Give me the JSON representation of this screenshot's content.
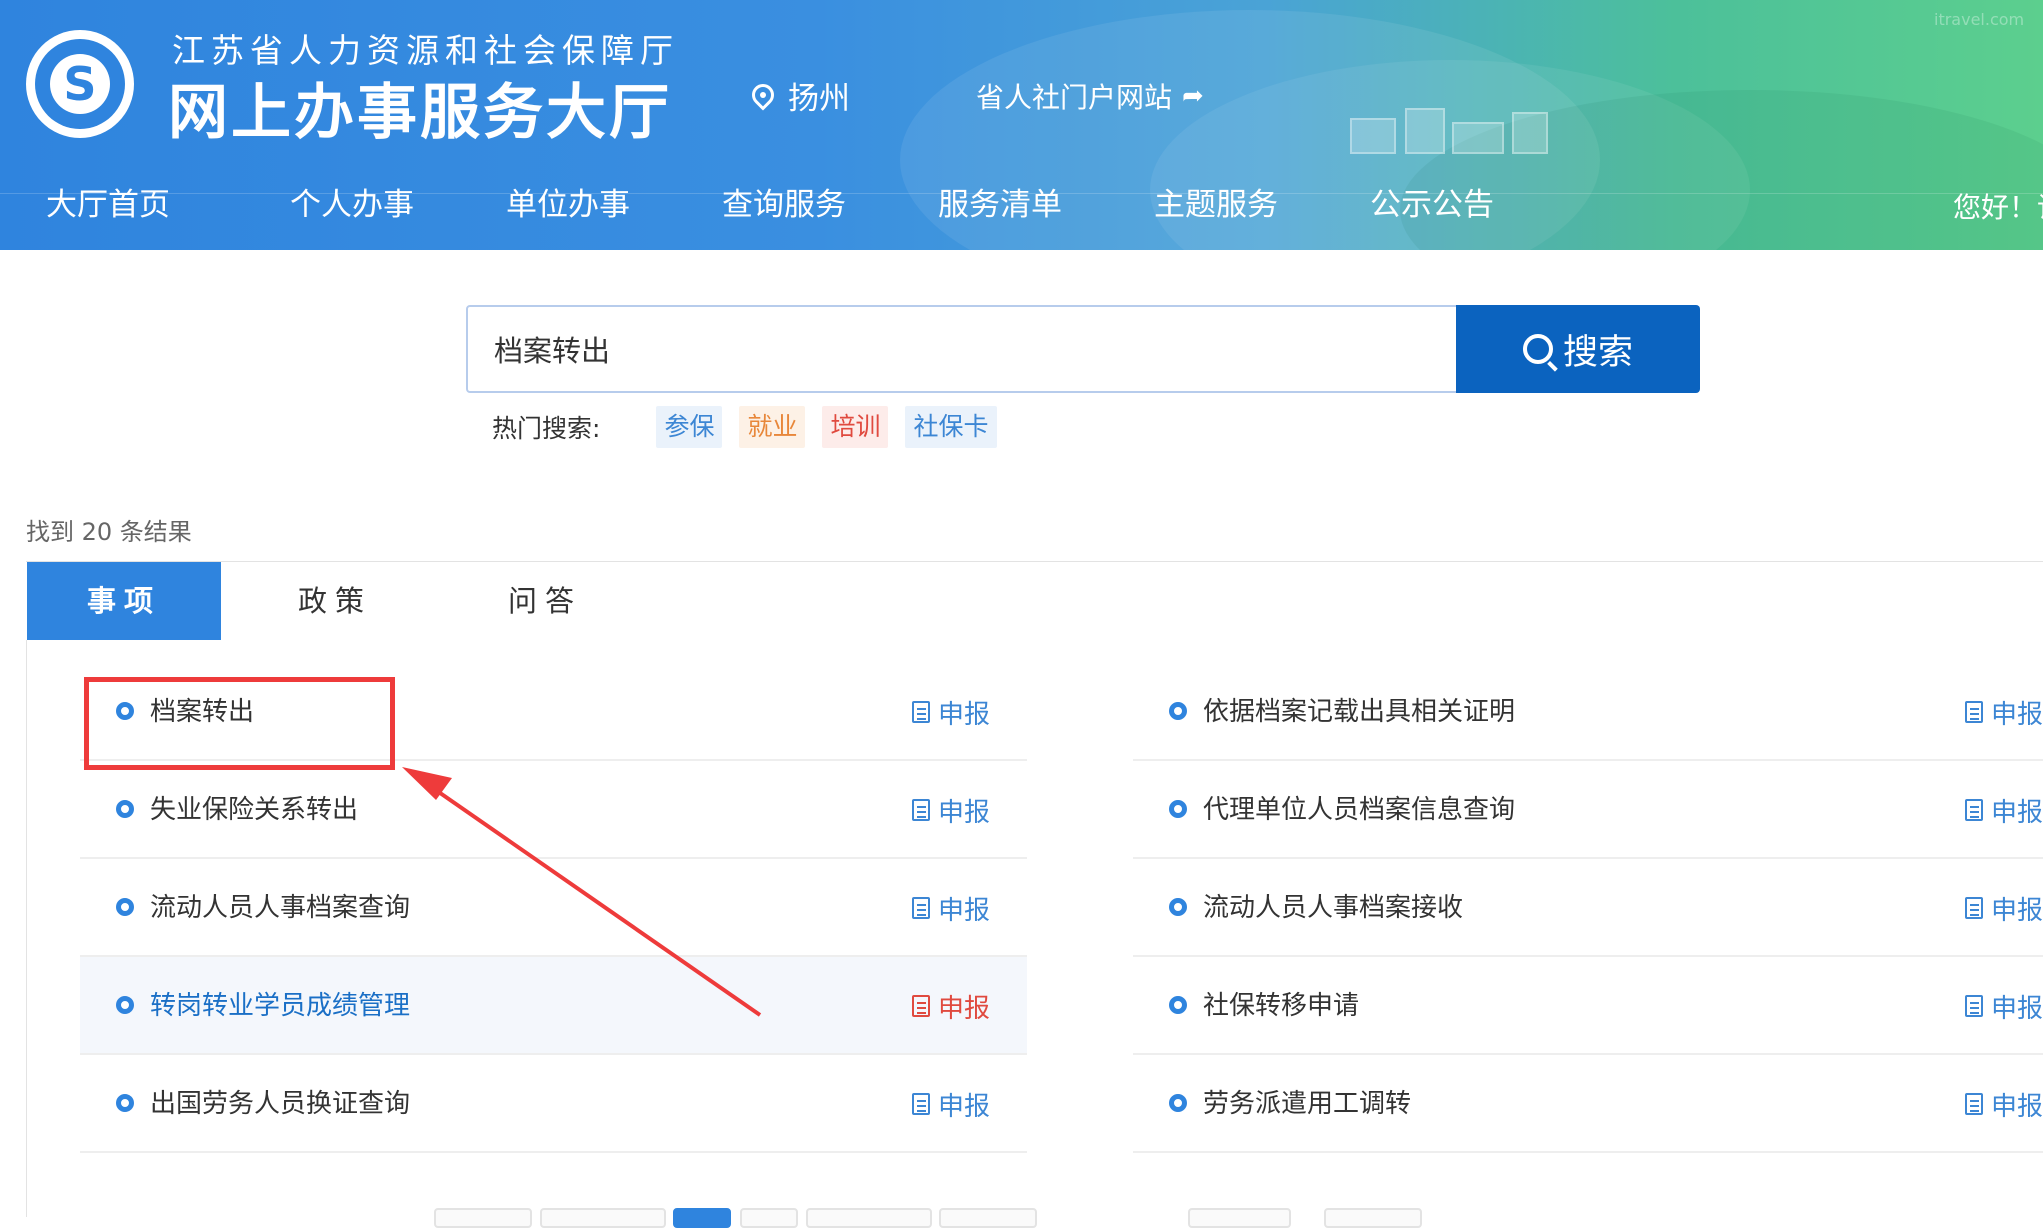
{
  "header": {
    "subtitle": "江苏省人力资源和社会保障厅",
    "title": "网上办事服务大厅",
    "location": "扬州",
    "portal_link": "省人社门户网站",
    "greeting": "您好！请",
    "nav": [
      "大厅首页",
      "个人办事",
      "单位办事",
      "查询服务",
      "服务清单",
      "主题服务",
      "公示公告"
    ],
    "watermark": "itravel.com"
  },
  "search": {
    "value": "档案转出",
    "button_label": "搜索",
    "hot_label": "热门搜索:",
    "hot_tags": [
      {
        "label": "参保",
        "color": "#3c86d4",
        "bg": "#eaf2fb"
      },
      {
        "label": "就业",
        "color": "#e8873a",
        "bg": "#fdf1e6"
      },
      {
        "label": "培训",
        "color": "#e04a3f",
        "bg": "#fdecea"
      },
      {
        "label": "社保卡",
        "color": "#3c86d4",
        "bg": "#eaf2fb"
      }
    ]
  },
  "results": {
    "count_text": "找到  20  条结果",
    "tabs": [
      "事项",
      "政策",
      "问答"
    ],
    "apply_label": "申报",
    "left": [
      "档案转出",
      "失业保险关系转出",
      "流动人员人事档案查询",
      "转岗转业学员成绩管理",
      "出国劳务人员换证查询"
    ],
    "right": [
      "依据档案记载出具相关证明",
      "代理单位人员档案信息查询",
      "流动人员人事档案接收",
      "社保转移申请",
      "劳务派遣用工调转"
    ]
  },
  "colors": {
    "primary": "#2f84de",
    "search_button": "#0b63bf",
    "annotation_red": "#ee3b3b",
    "highlight_text": "#1a6fc6",
    "highlight_apply": "#e04a3f"
  }
}
